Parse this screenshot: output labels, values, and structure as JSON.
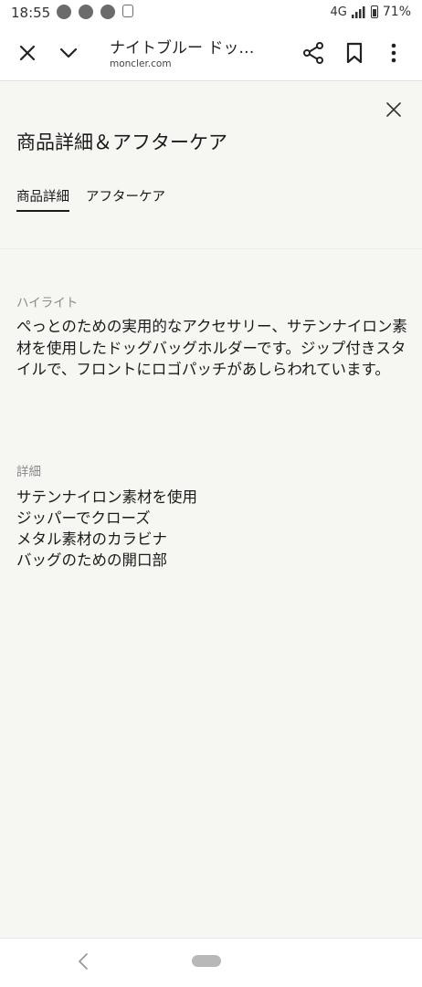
{
  "status_bar": {
    "time": "18:55",
    "network": "4G",
    "battery": "71%"
  },
  "browser": {
    "title": "ナイトブルー ドッ…",
    "url": "moncler.com"
  },
  "panel": {
    "title": "商品詳細＆アフターケア",
    "tabs": [
      {
        "label": "商品詳細",
        "active": true
      },
      {
        "label": "アフターケア",
        "active": false
      }
    ],
    "highlight_label": "ハイライト",
    "highlight_text": "ぺっとのための実用的なアクセサリー、サテンナイロン素材を使用したドッグバッグホルダーです。ジップ付きスタイルで、フロントにロゴパッチがあしらわれています。",
    "details_label": "詳細",
    "details": [
      "サテンナイロン素材を使用",
      "ジッパーでクローズ",
      "メタル素材のカラビナ",
      "バッグのための開口部"
    ]
  },
  "colors": {
    "background": "#f6f6f2",
    "text": "#1a1a1a",
    "muted": "#8a8a8a"
  }
}
